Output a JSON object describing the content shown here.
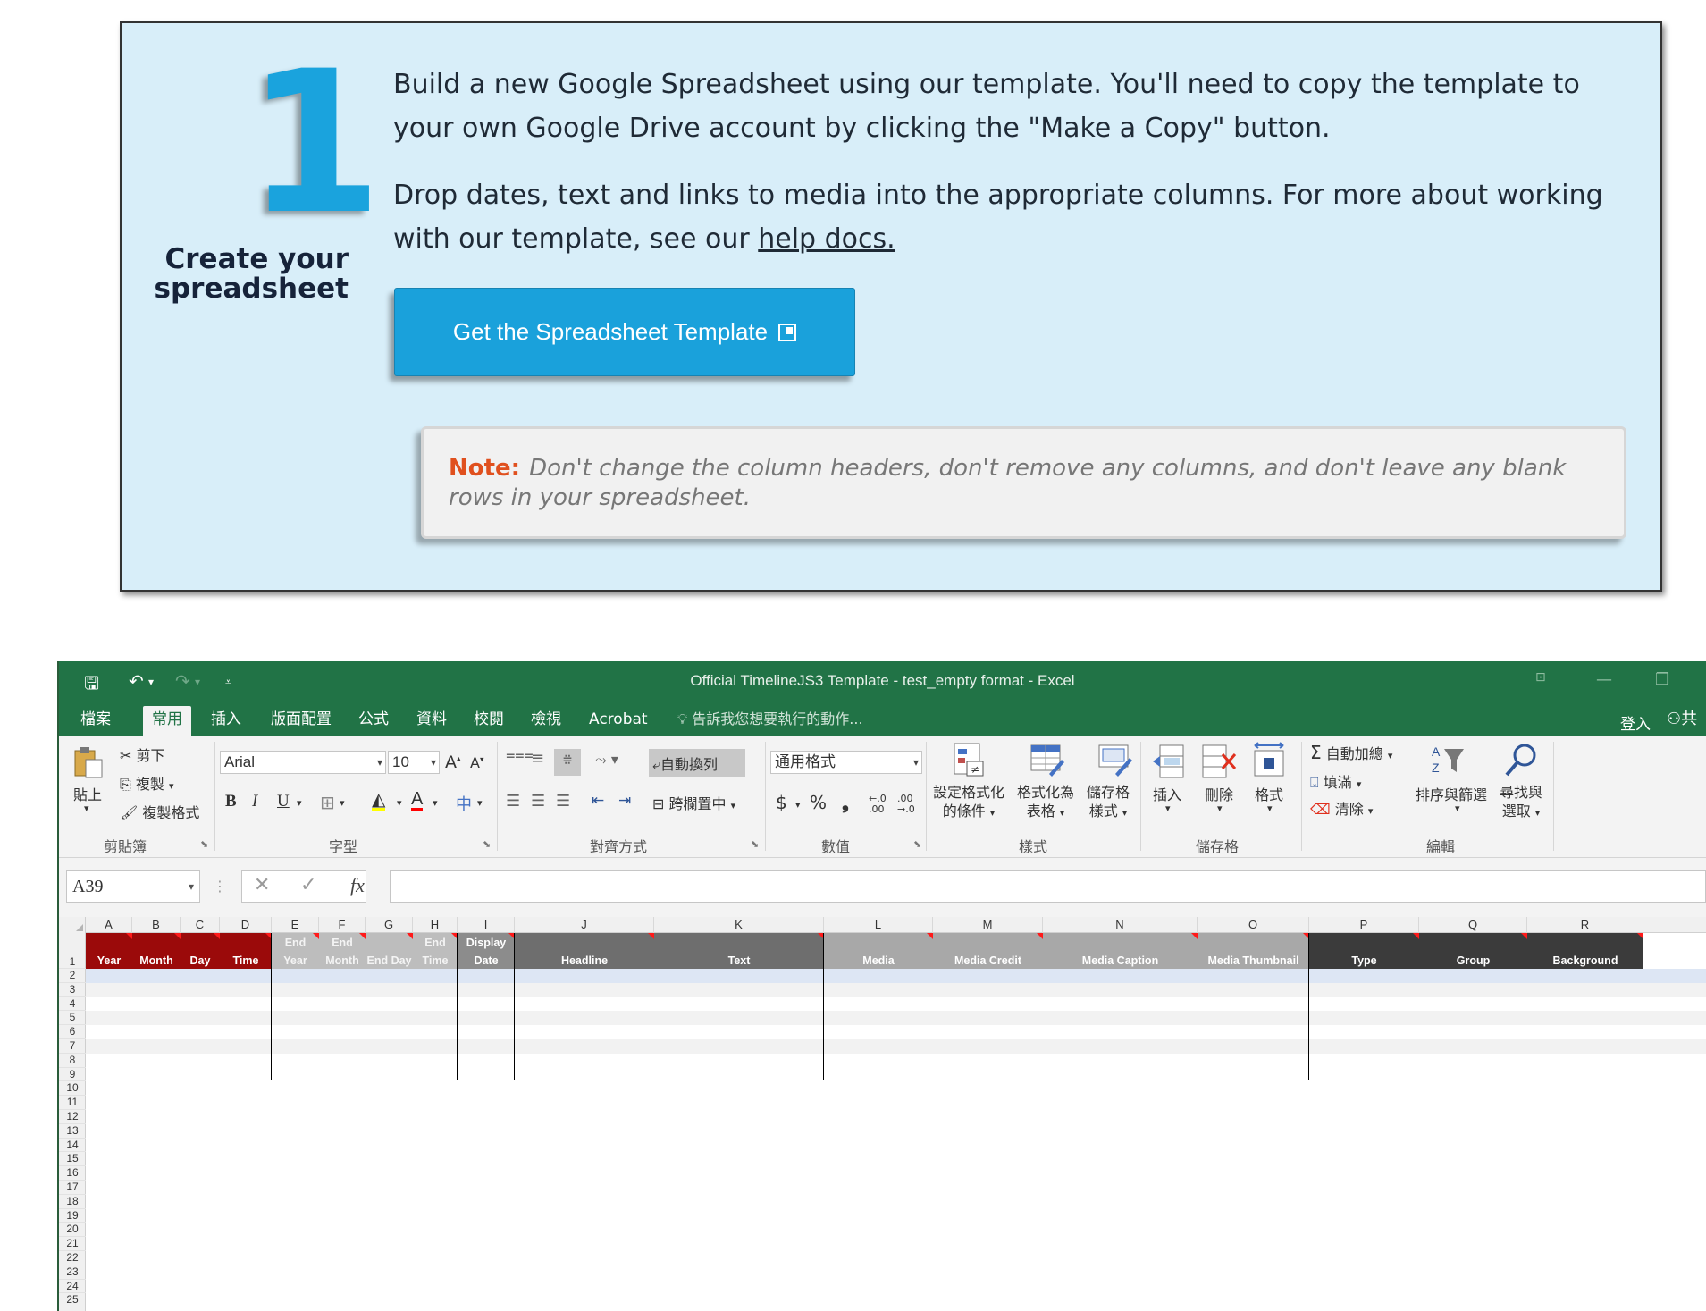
{
  "instructions": {
    "step_number": "1",
    "step_title_line1": "Create your",
    "step_title_line2": "spreadsheet",
    "para1": "Build a new Google Spreadsheet using our template. You'll need to copy the template to your own Google Drive account by clicking the \"Make a Copy\" button.",
    "para2_before": "Drop dates, text and links to media into the appropriate columns. For more about working with our template, see our ",
    "para2_link": "help docs.",
    "cta_label": "Get the Spreadsheet Template",
    "note_label": "Note:",
    "note_text": "Don't change the column headers, don't remove any columns, and don't leave any blank rows in your spreadsheet.",
    "colors": {
      "card_bg": "#d8eef9",
      "accent": "#1aa3dd",
      "note_label": "#e0501e"
    }
  },
  "excel": {
    "window_title": "Official TimelineJS3 Template - test_empty format - Excel",
    "menu": [
      "檔案",
      "常用",
      "插入",
      "版面配置",
      "公式",
      "資料",
      "校閱",
      "檢視",
      "Acrobat"
    ],
    "active_menu": "常用",
    "tell_me": "告訴我您想要執行的動作...",
    "sign_in": "登入",
    "share_partial": "共",
    "ribbon": {
      "clipboard": {
        "label": "剪貼簿",
        "paste": "貼上",
        "cut": "剪下",
        "copy": "複製",
        "format_painter": "複製格式"
      },
      "font": {
        "label": "字型",
        "font_name": "Arial",
        "font_size": "10",
        "bold": "B",
        "italic": "I",
        "underline": "U"
      },
      "alignment": {
        "label": "對齊方式",
        "wrap_text": "自動換列",
        "merge_center": "跨欄置中"
      },
      "number": {
        "label": "數值",
        "format": "通用格式",
        "currency": "$",
        "percent": "%",
        "comma": "❟"
      },
      "styles": {
        "label": "樣式",
        "conditional_l1": "設定格式化",
        "conditional_l2": "的條件",
        "table_l1": "格式化為",
        "table_l2": "表格",
        "cell_l1": "儲存格",
        "cell_l2": "樣式"
      },
      "cells": {
        "label": "儲存格",
        "insert": "插入",
        "delete": "刪除",
        "format": "格式"
      },
      "editing": {
        "label": "編輯",
        "autosum": "自動加總",
        "fill": "填滿",
        "clear": "清除",
        "sort_filter": "排序與篩選",
        "find_l1": "尋找與",
        "find_l2": "選取"
      }
    },
    "name_box": "A39",
    "fx_label": "fx",
    "columns": [
      "A",
      "B",
      "C",
      "D",
      "E",
      "F",
      "G",
      "H",
      "I",
      "J",
      "K",
      "L",
      "M",
      "N",
      "O",
      "P",
      "Q",
      "R"
    ],
    "headers": {
      "A": {
        "top": "",
        "bottom": "Year"
      },
      "B": {
        "top": "",
        "bottom": "Month"
      },
      "C": {
        "top": "",
        "bottom": "Day"
      },
      "D": {
        "top": "",
        "bottom": "Time"
      },
      "E": {
        "top": "End",
        "bottom": "Year"
      },
      "F": {
        "top": "End",
        "bottom": "Month"
      },
      "G": {
        "top": "",
        "bottom": "End Day"
      },
      "H": {
        "top": "End",
        "bottom": "Time"
      },
      "I": {
        "top": "Display",
        "bottom": "Date"
      },
      "J": {
        "top": "",
        "bottom": "Headline"
      },
      "K": {
        "top": "",
        "bottom": "Text"
      },
      "L": {
        "top": "",
        "bottom": "Media"
      },
      "M": {
        "top": "",
        "bottom": "Media Credit"
      },
      "N": {
        "top": "",
        "bottom": "Media Caption"
      },
      "O": {
        "top": "",
        "bottom": "Media Thumbnail"
      },
      "P": {
        "top": "",
        "bottom": "Type"
      },
      "Q": {
        "top": "",
        "bottom": "Group"
      },
      "R": {
        "top": "",
        "bottom": "Background"
      }
    },
    "row_numbers": [
      "1",
      "2",
      "3",
      "4",
      "5",
      "6",
      "7",
      "8",
      "9",
      "10",
      "11",
      "12",
      "13",
      "14",
      "15",
      "16",
      "17",
      "18",
      "19",
      "20",
      "21",
      "22",
      "23",
      "24",
      "25"
    ],
    "header_colors": {
      "date": "#9b0a0a",
      "end": "#bdbdbd",
      "display": "#8c8c8c",
      "text": "#6e6e6e",
      "media": "#a8a8a8",
      "meta": "#3b3b3b"
    }
  }
}
